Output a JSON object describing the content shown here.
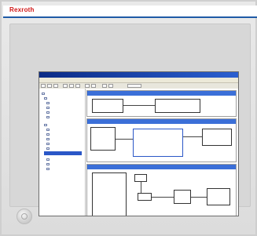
{
  "brand": {
    "name": "Rexroth",
    "accent_color": "#d01616",
    "rule_color": "#1f5aa6"
  },
  "screen": {
    "window_title": "",
    "menu": [],
    "toolbar": {
      "icons": [
        "new-icon",
        "open-icon",
        "save-icon",
        "cut-icon",
        "copy-icon",
        "paste-icon",
        "undo-icon",
        "redo-icon",
        "run-icon",
        "stop-icon"
      ]
    },
    "left_tree": {
      "items": []
    },
    "panels": [
      {
        "id": "panel-top",
        "title": ""
      },
      {
        "id": "panel-mid",
        "title": ""
      },
      {
        "id": "panel-bottom",
        "title": ""
      }
    ],
    "status": {
      "text": ""
    }
  },
  "device": {
    "badge": "device-logo-badge"
  }
}
